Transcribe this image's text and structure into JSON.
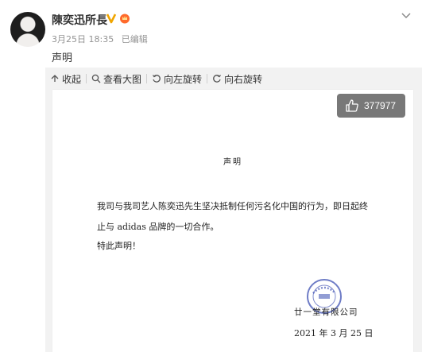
{
  "post": {
    "username": "陳奕迅所長",
    "date": "3月25日 18:35",
    "edited": "已编辑",
    "text": "声明"
  },
  "toolbar": {
    "collapse": "收起",
    "view_large": "查看大图",
    "rotate_left": "向左旋转",
    "rotate_right": "向右旋转"
  },
  "image": {
    "likes": "377977",
    "doc": {
      "title": "声明",
      "paragraph1": "我司与我司艺人陈奕迅先生坚决抵制任何污名化中国的行为，即日起终止与 adidas 品牌的一切合作。",
      "paragraph2": "特此声明！",
      "company": "廿一堂有限公司",
      "date": "2021 年 3 月 25 日"
    }
  },
  "colors": {
    "verified": "#f0a500",
    "toolbar_bg": "#f2f2f2",
    "seal": "#4a5bb8"
  },
  "icons": [
    "verified-v-icon",
    "fan-badge-icon",
    "chevron-down-icon",
    "collapse-icon",
    "magnifier-icon",
    "rotate-left-icon",
    "rotate-right-icon",
    "thumbs-up-icon",
    "company-seal"
  ]
}
